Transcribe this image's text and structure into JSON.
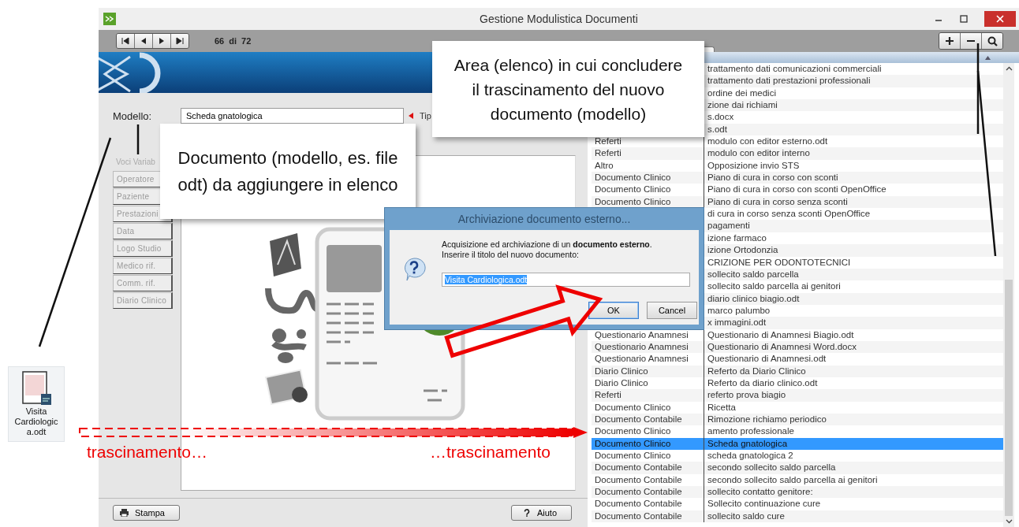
{
  "desktop_file": {
    "label": "Visita Cardiologica.odt"
  },
  "window": {
    "title": "Gestione Modulistica Documenti"
  },
  "navigator": {
    "record": "66",
    "of_label": "di",
    "total": "72"
  },
  "form": {
    "model_label": "Modello:",
    "model_value": "Scheda gnatologica",
    "type_label": "Tip"
  },
  "variables": {
    "header": "Voci Variab",
    "items": [
      "Operatore",
      "Paziente",
      "Prestazioni",
      "Data",
      "Logo Studio",
      "Medico rif.",
      "Comm. rif.",
      "Diario Clinico"
    ]
  },
  "footer_buttons": [
    {
      "label": "Stampa",
      "kind": "print"
    },
    {
      "label": "Aiuto",
      "kind": "help"
    }
  ],
  "list": {
    "rows": [
      {
        "name": "trattamento dati comunicazioni commerciali",
        "selected": false
      },
      {
        "name": "trattamento dati prestazioni professionali",
        "selected": false
      },
      {
        "name": "ordine dei medici",
        "selected": false
      },
      {
        "name": "zione dai richiami",
        "selected": false
      },
      {
        "name": "s.docx",
        "selected": false
      },
      {
        "name": "s.odt",
        "selected": false
      },
      {
        "type": "Referti",
        "name": "modulo con editor esterno.odt",
        "selected": false
      },
      {
        "type": "Referti",
        "name": "modulo con editor interno",
        "selected": false
      },
      {
        "type": "Altro",
        "name": "Opposizione invio STS",
        "selected": false
      },
      {
        "type": "Documento Clinico",
        "name": "Piano di cura in corso con sconti",
        "selected": false
      },
      {
        "type": "Documento Clinico",
        "name": "Piano di cura in corso con sconti OpenOffice",
        "selected": false
      },
      {
        "type": "Documento Clinico",
        "name": "Piano di cura in corso senza sconti",
        "selected": false
      },
      {
        "name": "di cura in corso senza sconti OpenOffice",
        "selected": false
      },
      {
        "name": "pagamenti",
        "selected": false
      },
      {
        "name": "izione farmaco",
        "selected": false
      },
      {
        "name": "izione Ortodonzia",
        "selected": false
      },
      {
        "name": "CRIZIONE PER ODONTOTECNICI",
        "selected": false
      },
      {
        "name": "sollecito saldo parcella",
        "selected": false
      },
      {
        "name": "sollecito saldo parcella ai genitori",
        "selected": false
      },
      {
        "name": "diario clinico biagio.odt",
        "selected": false
      },
      {
        "name": "marco palumbo",
        "selected": false
      },
      {
        "name": "x immagini.odt",
        "selected": false
      },
      {
        "type": "Questionario Anamnesi",
        "name": "Questionario di Anamnesi Biagio.odt",
        "selected": false
      },
      {
        "type": "Questionario Anamnesi",
        "name": "Questionario di Anamnesi Word.docx",
        "selected": false
      },
      {
        "type": "Questionario Anamnesi",
        "name": "Questionario di Anamnesi.odt",
        "selected": false
      },
      {
        "type": "Diario Clinico",
        "name": "Referto da Diario Clinico",
        "selected": false
      },
      {
        "type": "Diario Clinico",
        "name": "Referto da diario clinico.odt",
        "selected": false
      },
      {
        "type": "Referti",
        "name": "referto prova biagio",
        "selected": false
      },
      {
        "type": "Documento Clinico",
        "name": "Ricetta",
        "selected": false
      },
      {
        "type": "Documento Contabile",
        "name": "Rimozione richiamo periodico",
        "selected": false
      },
      {
        "type": "Documento Clinico",
        "name": "amento professionale",
        "selected": false
      },
      {
        "type": "Documento Clinico",
        "name": "Scheda gnatologica",
        "selected": true
      },
      {
        "type": "Documento Clinico",
        "name": "scheda gnatologica 2",
        "selected": false
      },
      {
        "type": "Documento Contabile",
        "name": "secondo sollecito saldo parcella",
        "selected": false
      },
      {
        "type": "Documento Contabile",
        "name": "secondo sollecito saldo parcella ai genitori",
        "selected": false
      },
      {
        "type": "Documento Contabile",
        "name": "sollecito contatto genitore:",
        "selected": false
      },
      {
        "type": "Documento Contabile",
        "name": "Sollecito continuazione cure",
        "selected": false
      },
      {
        "type": "Documento Contabile",
        "name": "sollecito saldo cure",
        "selected": false
      }
    ]
  },
  "dialog": {
    "title": "Archiviazione documento esterno...",
    "message": "Acquisizione ed archiviazione di un **documento esterno**.",
    "prompt": "Inserire il titolo del nuovo documento:",
    "value": "Visita Cardiologica.odt",
    "buttons": [
      {
        "label": "OK",
        "kind": "default"
      },
      {
        "label": "Cancel",
        "kind": "normal"
      }
    ]
  },
  "annotations": {
    "list_callout": "Area (elenco) in cui concludere il trascinamento del nuovo documento (modello)",
    "document_callout": "Documento (modello, es. file odt) da aggiungere in elenco",
    "drag_start": "trascinamento…",
    "drag_end": "…trascinamento"
  }
}
